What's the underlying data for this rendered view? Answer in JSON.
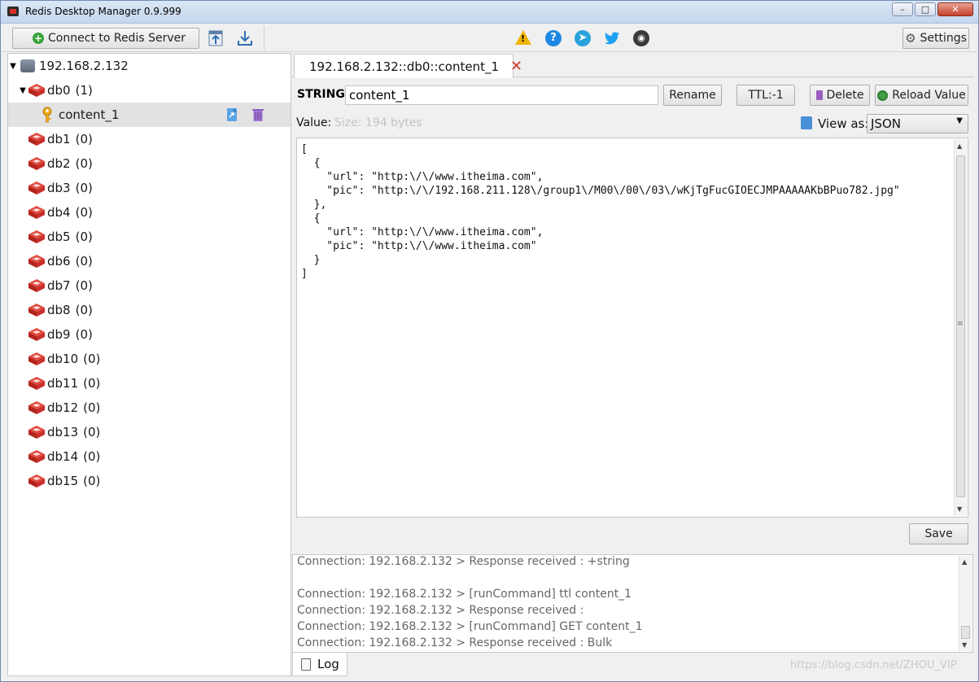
{
  "window": {
    "title": "Redis Desktop Manager 0.9.999",
    "controls": [
      "minimize",
      "maximize",
      "close"
    ]
  },
  "toolbar": {
    "connect_label": "Connect to Redis Server",
    "import_icon": "import-icon",
    "export_icon": "export-icon",
    "settings_label": "Settings",
    "social_icons": [
      "warning-icon",
      "help-icon",
      "telegram-icon",
      "twitter-icon",
      "github-icon"
    ]
  },
  "tree": {
    "server": "192.168.2.132",
    "db0": {
      "name": "db0",
      "count": "(1)"
    },
    "selected_key": "content_1",
    "dbs": [
      {
        "name": "db1",
        "count": "(0)"
      },
      {
        "name": "db2",
        "count": "(0)"
      },
      {
        "name": "db3",
        "count": "(0)"
      },
      {
        "name": "db4",
        "count": "(0)"
      },
      {
        "name": "db5",
        "count": "(0)"
      },
      {
        "name": "db6",
        "count": "(0)"
      },
      {
        "name": "db7",
        "count": "(0)"
      },
      {
        "name": "db8",
        "count": "(0)"
      },
      {
        "name": "db9",
        "count": "(0)"
      },
      {
        "name": "db10",
        "count": "(0)"
      },
      {
        "name": "db11",
        "count": "(0)"
      },
      {
        "name": "db12",
        "count": "(0)"
      },
      {
        "name": "db13",
        "count": "(0)"
      },
      {
        "name": "db14",
        "count": "(0)"
      },
      {
        "name": "db15",
        "count": "(0)"
      }
    ]
  },
  "tab": {
    "title": "192.168.2.132::db0::content_1"
  },
  "key_panel": {
    "type_label": "STRING:",
    "key_name": "content_1",
    "rename_label": "Rename",
    "ttl_label": "TTL:-1",
    "delete_label": "Delete",
    "reload_label": "Reload Value",
    "value_label": "Value:",
    "size_label": "Size: 194 bytes",
    "view_as_label": "View as:",
    "view_as_value": "JSON",
    "save_label": "Save"
  },
  "editor": {
    "text": "[\n  {\n    \"url\": \"http:\\/\\/www.itheima.com\",\n    \"pic\": \"http:\\/\\/192.168.211.128\\/group1\\/M00\\/00\\/03\\/wKjTgFucGIOECJMPAAAAAKbBPuo782.jpg\"\n  },\n  {\n    \"url\": \"http:\\/\\/www.itheima.com\",\n    \"pic\": \"http:\\/\\/www.itheima.com\"\n  }\n]"
  },
  "log": {
    "lines": [
      "Connection: 192.168.2.132 > Response received : +string",
      "",
      "Connection: 192.168.2.132 > [runCommand] ttl content_1",
      "Connection: 192.168.2.132 > Response received :",
      "Connection: 192.168.2.132 > [runCommand] GET content_1",
      "Connection: 192.168.2.132 > Response received : Bulk"
    ],
    "tab_label": "Log"
  },
  "watermark": "https://blog.csdn.net/ZHOU_VIP",
  "colors": {
    "accent_red": "#d43a2a",
    "db_red": "#c9302c",
    "key_orange": "#e8a317",
    "selection": "#e2e2e2"
  }
}
